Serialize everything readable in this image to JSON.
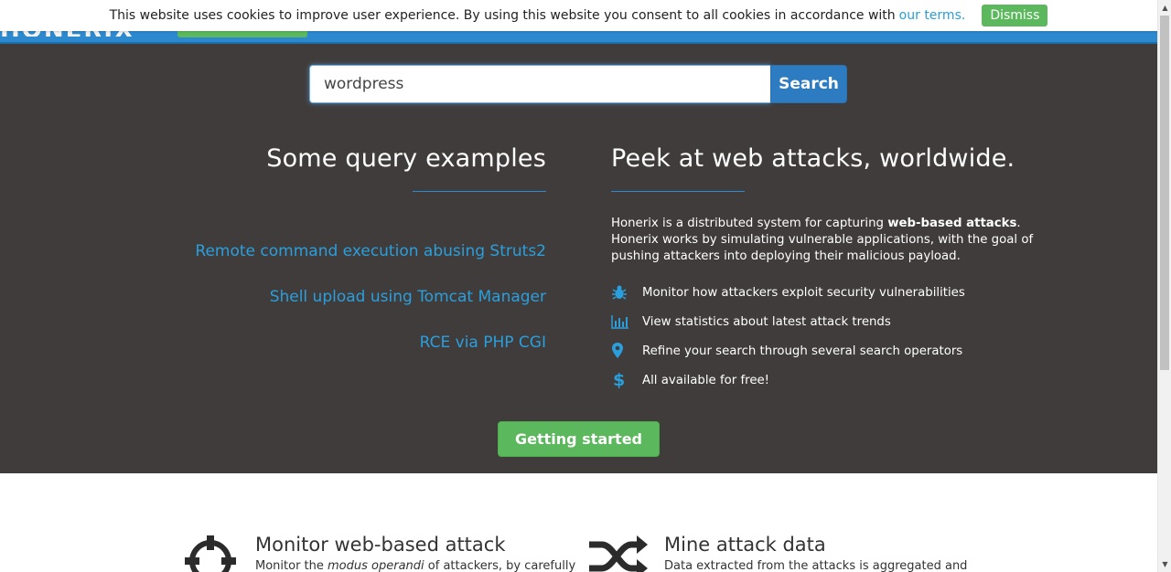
{
  "cookie_bar": {
    "message": "This website uses cookies to improve user experience. By using this website you consent to all cookies in accordance with",
    "link_text": "our terms.",
    "dismiss_label": "Dismiss"
  },
  "search": {
    "value": "wordpress",
    "button_label": "Search"
  },
  "examples": {
    "heading": "Some query examples",
    "links": [
      "Remote command execution abusing Struts2",
      "Shell upload using Tomcat Manager",
      "RCE via PHP CGI"
    ]
  },
  "about": {
    "heading": "Peek at web attacks, worldwide.",
    "intro_prefix": "Honerix is a distributed system for capturing ",
    "intro_bold": "web-based attacks",
    "intro_suffix": ". Honerix works by simulating vulnerable applications, with the goal of pushing attackers into deploying their malicious payload.",
    "features": [
      {
        "icon": "bug-icon",
        "text": "Monitor how attackers exploit security vulnerabilities"
      },
      {
        "icon": "bar-chart-icon",
        "text": "View statistics about latest attack trends"
      },
      {
        "icon": "map-marker-icon",
        "text": "Refine your search through several search operators"
      },
      {
        "icon": "dollar-icon",
        "text": "All available for free!"
      }
    ]
  },
  "cta": {
    "label": "Getting started"
  },
  "lower": {
    "block1": {
      "icon": "crosshairs-icon",
      "title": "Monitor web-based attack",
      "text_prefix": "Monitor the ",
      "text_italic": "modus operandi",
      "text_suffix": " of attackers, by carefully"
    },
    "block2": {
      "icon": "shuffle-icon",
      "title": "Mine attack data",
      "text": "Data extracted from the attacks is aggregated and"
    }
  },
  "colors": {
    "hero_bg": "#403c3b",
    "accent_blue": "#2d89cd",
    "link_blue": "#2a9fdd",
    "green": "#5cb85c"
  }
}
